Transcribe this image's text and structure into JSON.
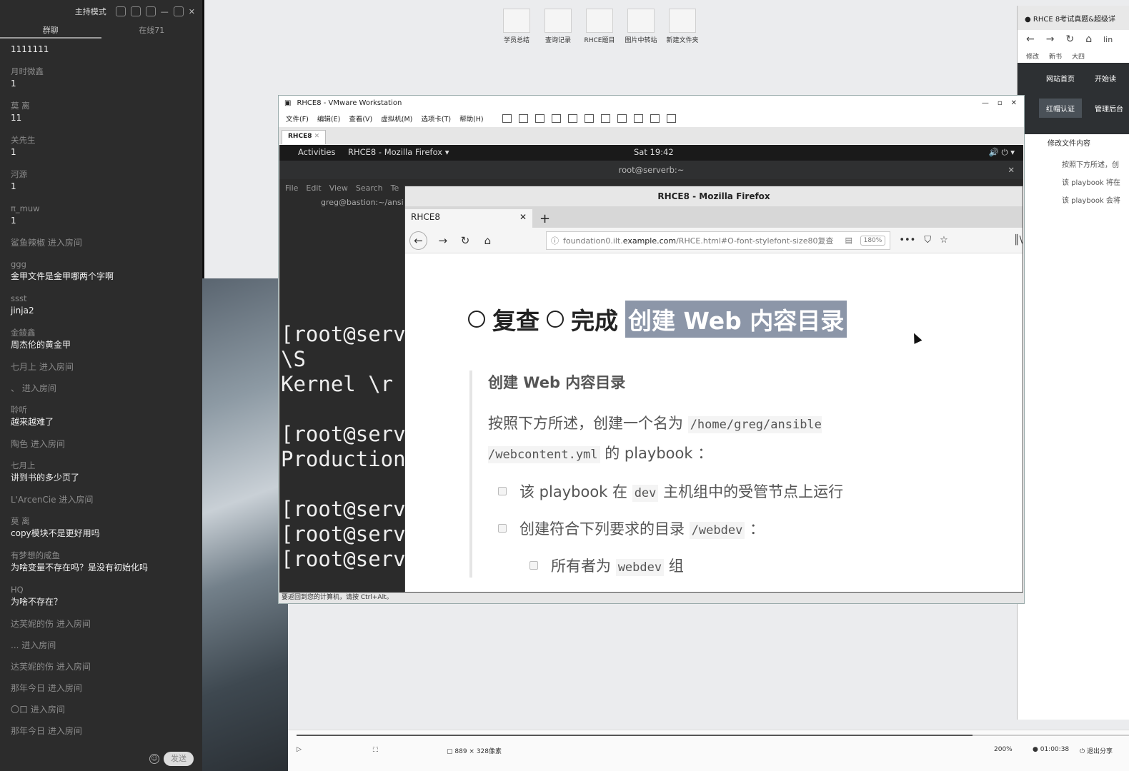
{
  "chat": {
    "host_label": "主持模式",
    "tabs": [
      "群聊",
      "在线71"
    ],
    "messages": [
      {
        "name": "",
        "text": "1111111"
      },
      {
        "name": "月时微鑫",
        "text": "1"
      },
      {
        "name": "莫 离",
        "text": "11"
      },
      {
        "name": "关先生",
        "text": "1"
      },
      {
        "name": "河源",
        "text": "1"
      },
      {
        "name": "π_muw",
        "text": "1"
      },
      {
        "sys": "鲨鱼辣椒 进入房间"
      },
      {
        "name": "ggg",
        "text": "金甲文件是金甲哪两个字啊"
      },
      {
        "name": "ssst",
        "text": "jinja2"
      },
      {
        "name": "金錂鑫",
        "text": "周杰伦的黄金甲"
      },
      {
        "sys": "七月上 进入房间"
      },
      {
        "sys": "、 进入房间"
      },
      {
        "name": "聆听",
        "text": "越来越难了"
      },
      {
        "sys": "陶色 进入房间"
      },
      {
        "name": "七月上",
        "text": "讲到书的多少页了"
      },
      {
        "sys": "L'ArcenCie 进入房间"
      },
      {
        "name": "莫 离",
        "text": "copy模块不是更好用吗"
      },
      {
        "name": "有梦想的咸鱼",
        "text": "为啥变量不存在吗？是没有初始化吗"
      },
      {
        "name": "HQ",
        "text": "为啥不存在？"
      },
      {
        "sys": "达芙妮的伤 进入房间"
      },
      {
        "sys": "... 进入房间"
      },
      {
        "sys": "达芙妮的伤 进入房间"
      },
      {
        "sys": "那年今日 进入房间"
      },
      {
        "sys": "〇口 进入房间"
      },
      {
        "sys": "那年今日 进入房间"
      }
    ],
    "send_label": "发送"
  },
  "desktop": {
    "shortcuts": [
      "学员总结",
      "查询记录",
      "RHCE题目",
      "图片中转站",
      "新建文件夹"
    ]
  },
  "right_browser": {
    "tab_title": "RHCE 8考试真题&超级详",
    "url_fragment": "lin",
    "bookmarks": [
      "修改",
      "新书",
      "大四"
    ],
    "nav": [
      "网站首页",
      "开始读",
      "红帽认证",
      "管理后台"
    ],
    "section": "修改文件内容",
    "lines": [
      "按照下方所述，创",
      "该 playbook 将在",
      "该 playbook 会将"
    ]
  },
  "vmware": {
    "title": "RHCE8 - VMware Workstation",
    "menu": [
      "文件(F)",
      "编辑(E)",
      "查看(V)",
      "虚拟机(M)",
      "选项卡(T)",
      "帮助(H)"
    ],
    "tab": "RHCE8",
    "status": "要返回到您的计算机，请按 Ctrl+Alt。"
  },
  "gnome": {
    "activities": "Activities",
    "app": "RHCE8 - Mozilla Firefox ▾",
    "clock": "Sat 19:42",
    "system": "🔊  ⏻  ▾"
  },
  "terminal": {
    "title": "root@serverb:~",
    "menu": [
      "File",
      "Edit",
      "View",
      "Search",
      "Te"
    ],
    "subtab": "greg@bastion:~/ansi",
    "lines": [
      "[root@serv",
      "\\S",
      "Kernel \\r",
      "",
      "[root@serv",
      "Production",
      "",
      "[root@serv",
      "[root@serv",
      "[root@serv"
    ]
  },
  "firefox": {
    "window_title": "RHCE8 - Mozilla Firefox",
    "tab_title": "RHCE8",
    "url_prefix": "foundation0.ilt.",
    "url_domain": "example.com",
    "url_rest": "/RHCE.html#O-font-stylefont-size80复查",
    "zoom": "180%",
    "heading_review": "复查",
    "heading_done": "完成",
    "heading_highlight": "创建 Web 内容目录",
    "section_title": "创建 Web 内容目录",
    "para_before": "按照下方所述，创建一个名为",
    "para_code": "/home/greg/ansible /webcontent.yml",
    "para_after": "的 playbook ：",
    "item1_before": "该 playbook 在",
    "item1_code": "dev",
    "item1_after": "主机组中的受管节点上运行",
    "item2_before": "创建符合下列要求的目录",
    "item2_code": "/webdev",
    "item2_after": "：",
    "item3_before": "所有者为",
    "item3_code": "webdev",
    "item3_after": "组"
  },
  "player": {
    "selection_size": "889 × 328像素",
    "zoom": "200%",
    "timer": "01:00:38",
    "exit_share": "退出分享"
  }
}
